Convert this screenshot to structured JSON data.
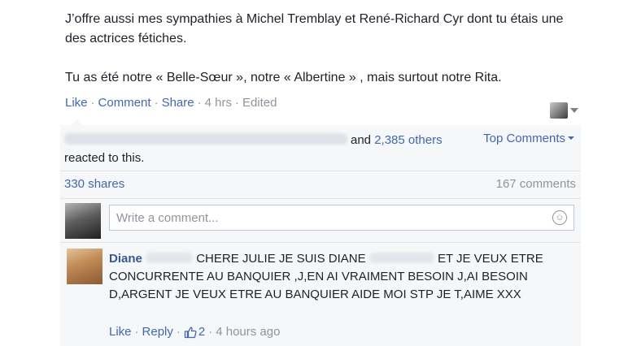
{
  "post": {
    "paragraph1": "J’offre aussi mes sympathies à Michel Tremblay et René-Richard Cyr dont tu étais une des actrices fétiches.",
    "paragraph2": "Tu as été notre « Belle-Sœur », notre « Albertine » , mais surtout notre Rita."
  },
  "actions": {
    "like": "Like",
    "comment": "Comment",
    "share": "Share",
    "time": "4 hrs",
    "edited": "Edited",
    "separator": "·"
  },
  "reactions": {
    "and_text": "and",
    "others": "2,385 others",
    "reacted_text": "reacted to this.",
    "top_comments": "Top Comments"
  },
  "stats": {
    "shares": "330 shares",
    "comments": "167 comments"
  },
  "composer": {
    "placeholder": "Write a comment..."
  },
  "comment": {
    "author_first": "Diane",
    "text_part1": "CHERE JULIE JE SUIS DIANE",
    "text_part2": "ET JE VEUX ETRE CONCURRENTE AU BANQUIER ,J,EN AI VRAIMENT BESOIN J,AI BESOIN D,ARGENT JE VEUX ETRE AU BANQUIER AIDE MOI STP JE T,AIME XXX",
    "like": "Like",
    "reply": "Reply",
    "like_count": "2",
    "time": "4 hours ago"
  },
  "colors": {
    "link": "#4267b2",
    "author": "#365899",
    "meta": "#90949c",
    "feedback_bg": "#f6f7f9"
  }
}
